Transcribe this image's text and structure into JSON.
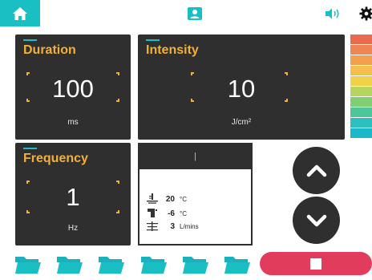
{
  "topbar": {
    "home_icon": "home-icon",
    "profile_icon": "profile-icon",
    "sound_icon": "speaker-icon",
    "settings_icon": "gear-icon",
    "active_color": "#1abfc4"
  },
  "duration": {
    "title": "Duration",
    "value": "100",
    "unit": "ms"
  },
  "intensity": {
    "title": "Intensity",
    "value": "10",
    "unit": "J/cm²"
  },
  "frequency": {
    "title": "Frequency",
    "value": "1",
    "unit": "Hz"
  },
  "status": {
    "header": "|",
    "rows": [
      {
        "icon": "temperature-base-icon",
        "value": "20",
        "unit": "°C"
      },
      {
        "icon": "tap-icon",
        "value": "-6",
        "unit": "°C"
      },
      {
        "icon": "flow-icon",
        "value": "3",
        "unit": "L/mins"
      }
    ]
  },
  "scale_colors": [
    "#ea6a4f",
    "#ee8654",
    "#f1a050",
    "#f3bf4c",
    "#f0d24a",
    "#b7d45e",
    "#7fcf73",
    "#4fc69a",
    "#2bbfc0",
    "#1ab8c8"
  ],
  "controls": {
    "up_icon": "chevron-up-icon",
    "down_icon": "chevron-down-icon",
    "stop_icon": "stop-icon"
  },
  "folders": [
    "folder-icon",
    "folder-icon",
    "folder-icon",
    "folder-icon",
    "folder-icon",
    "folder-icon"
  ],
  "colors": {
    "panel": "#2f2f2f",
    "title": "#f2b03a",
    "accent": "#1abfc4",
    "stop": "#e23c5c"
  }
}
